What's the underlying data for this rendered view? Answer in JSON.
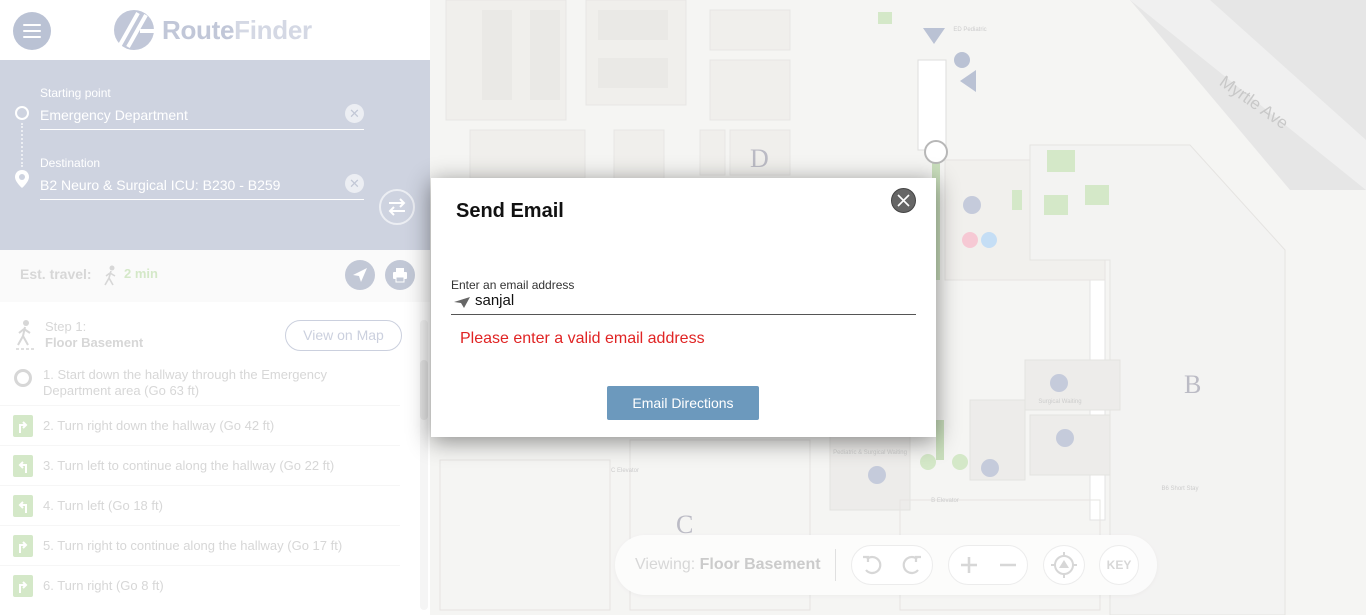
{
  "header": {
    "menu_icon": "hamburger-icon",
    "logo_icon": "route-finder-logo-icon",
    "logo_route": "Route",
    "logo_finder": "Finder"
  },
  "route": {
    "start_label": "Starting point",
    "start_value": "Emergency Department",
    "destination_label": "Destination",
    "destination_value": "B2 Neuro & Surgical ICU: B230 - B259",
    "clear_icon": "close-icon",
    "swap_icon": "swap-arrows-icon"
  },
  "travel": {
    "label": "Est. travel:",
    "time": "2 min",
    "walker_icon": "walking-person-icon",
    "send_icon": "send-icon",
    "print_icon": "print-icon"
  },
  "steps": {
    "step_label": "Step 1:",
    "floor": "Floor Basement",
    "view_map_label": "View on Map",
    "items": [
      {
        "text": "1. Start down the hallway through the Emergency Department area (Go 63 ft)",
        "icon": "start-circle-icon"
      },
      {
        "text": "2. Turn right down the hallway (Go 42 ft)",
        "icon": "turn-right-icon"
      },
      {
        "text": "3. Turn left to continue along the hallway (Go 22 ft)",
        "icon": "turn-left-icon"
      },
      {
        "text": "4. Turn left (Go 18 ft)",
        "icon": "turn-left-icon"
      },
      {
        "text": "5. Turn right to continue along the hallway (Go 17 ft)",
        "icon": "turn-right-icon"
      },
      {
        "text": "6. Turn right (Go 8 ft)",
        "icon": "turn-right-icon"
      }
    ]
  },
  "map": {
    "buildings": [
      "D",
      "B",
      "C"
    ],
    "street": "Myrtle Ave",
    "small_labels": [
      "ED Pediatric",
      "Surgical Waiting",
      "Pediatric & Surgical Waiting",
      "C Elevator",
      "B Elevator",
      "B6 Short Stay"
    ]
  },
  "viewing": {
    "prefix": "Viewing:",
    "floor": "Floor Basement",
    "key_label": "KEY",
    "undo_icon": "undo-icon",
    "redo_icon": "redo-icon",
    "zoom_in_icon": "plus-icon",
    "zoom_out_icon": "minus-icon",
    "locate_icon": "locate-icon"
  },
  "modal": {
    "title": "Send Email",
    "email_label": "Enter an email address",
    "email_value": "sanjal",
    "error": "Please enter a valid email address",
    "submit_label": "Email Directions",
    "colors": {
      "error": "#e02424",
      "button": "#6c99bd",
      "panel": "#aeb6cc"
    }
  }
}
